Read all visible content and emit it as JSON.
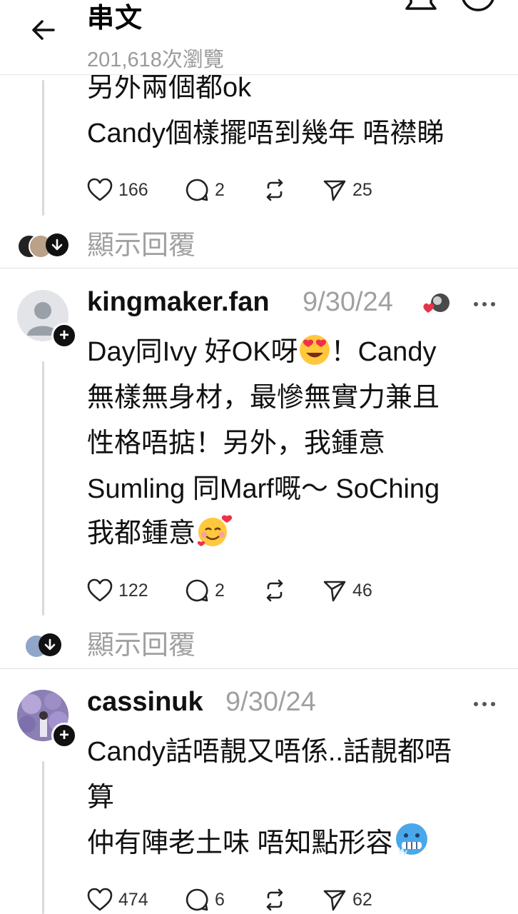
{
  "header": {
    "title": "串文",
    "views": "201,618次瀏覽"
  },
  "post0": {
    "lines": [
      "另外兩個都ok",
      "Candy個樣擺唔到幾年 唔襟睇"
    ],
    "likes": "166",
    "replies": "2",
    "shares": "25",
    "show_replies": "顯示回覆"
  },
  "post1": {
    "username": "kingmaker.fan",
    "date": "9/30/24",
    "line1_pre": "Day同Ivy 好OK呀",
    "line1_post": "！Candy",
    "line2": "無樣無身材，最慘無實力兼且",
    "line3": "性格唔掂！另外，我鍾意",
    "line4": "Sumling 同Marf嘅～ SoChing",
    "line5": "我都鍾意",
    "likes": "122",
    "replies": "2",
    "shares": "46",
    "show_replies": "顯示回覆"
  },
  "post2": {
    "username": "cassinuk",
    "date": "9/30/24",
    "line1": "Candy話唔靚又唔係..話靚都唔",
    "line2": "算",
    "line3": "仲有陣老土味 唔知點形容",
    "likes": "474",
    "replies": "6",
    "shares": "62"
  },
  "icons": {
    "back": "arrow-left-icon",
    "bell": "bell-icon",
    "more": "more-circle-icon",
    "like": "heart-icon",
    "reply": "comment-icon",
    "repost": "repost-icon",
    "share": "send-icon"
  }
}
